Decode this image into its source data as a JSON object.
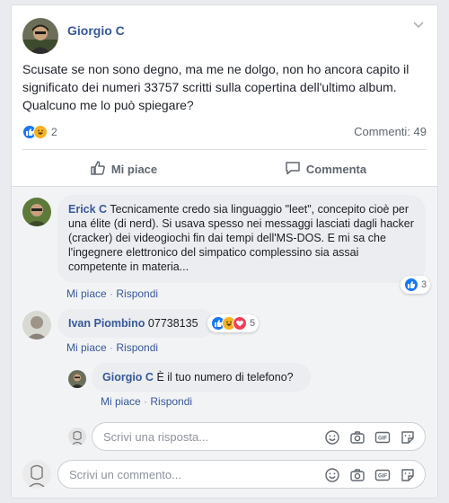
{
  "post": {
    "author": "Giorgio C",
    "text": "Scusate se non sono degno, ma me ne dolgo, non ho ancora capito il significato dei numeri 33757 scritti sulla copertina dell'ultimo album. Qualcuno me lo può spiegare?",
    "reaction_count": "2",
    "comments_label": "Commenti: 49"
  },
  "actions": {
    "like": "Mi piace",
    "comment": "Commenta"
  },
  "comments": [
    {
      "author": "Erick C",
      "text": "Tecnicamente credo sia linguaggio \"leet\", concepito cioè per una élite (di nerd). Si usava spesso nei messaggi lasciati dagli hacker (cracker) dei videogiochi fin dai tempi dell'MS-DOS. E mi sa che l'ingegnere elettronico del simpatico complessino sia assai competente in materia...",
      "like": "Mi piace",
      "reply": "Rispondi",
      "reactions": "3"
    },
    {
      "author": "Ivan Piombino",
      "text": "07738135",
      "like": "Mi piace",
      "reply": "Rispondi",
      "reactions": "5"
    }
  ],
  "reply": {
    "author": "Giorgio C",
    "text": "È il tuo numero di telefono?",
    "like": "Mi piace",
    "reply": "Rispondi"
  },
  "reply_input": {
    "placeholder": "Scrivi una risposta..."
  },
  "comment_input": {
    "placeholder": "Scrivi un commento..."
  },
  "colors": {
    "link": "#385898",
    "like_blue": "#1877f2",
    "haha_yellow": "#f7b125",
    "love_red": "#f33e58"
  }
}
